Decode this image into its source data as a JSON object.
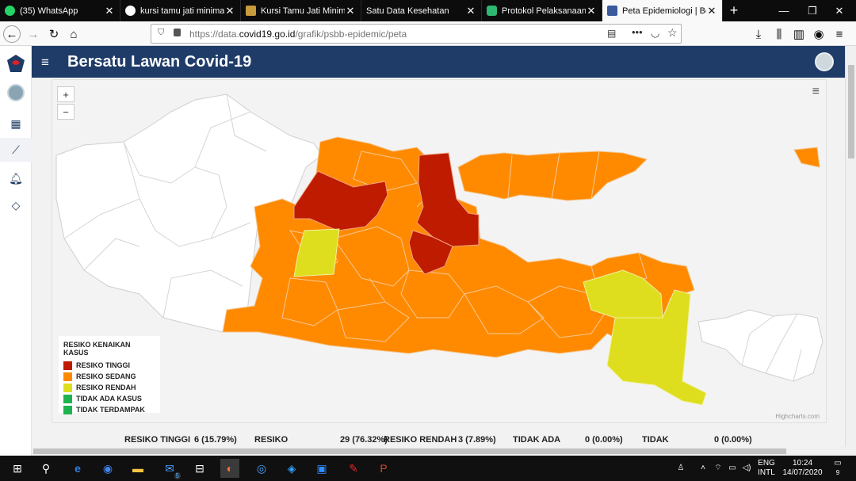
{
  "browser": {
    "tabs": [
      {
        "label": "(35) WhatsApp",
        "icon": "whatsapp-icon",
        "color": "#25d366"
      },
      {
        "label": "kursi tamu jati minimalis",
        "icon": "google-icon",
        "color": "#ffffff"
      },
      {
        "label": "Kursi Tamu Jati Minimalis",
        "icon": "crown-icon",
        "color": "#c89b3c"
      },
      {
        "label": "Satu Data Kesehatan",
        "icon": "",
        "color": ""
      },
      {
        "label": "Protokol Pelaksanaan Lay",
        "icon": "clover-icon",
        "color": "#2eb872"
      },
      {
        "label": "Peta Epidemiologi | Bersa",
        "icon": "garuda-icon",
        "color": "#3a5a9c",
        "active": true
      }
    ],
    "url_prefix": "https://data.",
    "url_domain": "covid19.go.id",
    "url_path": "/grafik/psbb-epidemic/peta"
  },
  "app": {
    "title": "Bersatu Lawan Covid-19"
  },
  "map": {
    "zoom_in": "+",
    "zoom_out": "−",
    "credits": "Highcharts.com",
    "legend": {
      "title": "RESIKO KENAIKAN KASUS",
      "items": [
        {
          "label": "RESIKO TINGGI",
          "color": "#bf1b00"
        },
        {
          "label": "RESIKO SEDANG",
          "color": "#ff8a00"
        },
        {
          "label": "RESIKO RENDAH",
          "color": "#dede1e"
        },
        {
          "label": "TIDAK ADA KASUS",
          "color": "#1fb350"
        },
        {
          "label": "TIDAK TERDAMPAK",
          "color": "#1fb350"
        }
      ]
    }
  },
  "stats": {
    "tinggi_label": "RESIKO TINGGI",
    "tinggi_value": "6 (15.79%)",
    "sedang_label": "RESIKO",
    "sedang_value": "29 (76.32%)",
    "rendah_label": "RESIKO RENDAH",
    "rendah_value": "3 (7.89%)",
    "tidakada_label": "TIDAK ADA",
    "tidakada_value": "0 (0.00%)",
    "tidak_label": "TIDAK",
    "tidak_value": "0 (0.00%)"
  },
  "taskbar": {
    "lang_top": "ENG",
    "lang_bottom": "INTL",
    "time": "10:24",
    "date": "14/07/2020",
    "notif_count": "9",
    "mail_badge": "5"
  }
}
